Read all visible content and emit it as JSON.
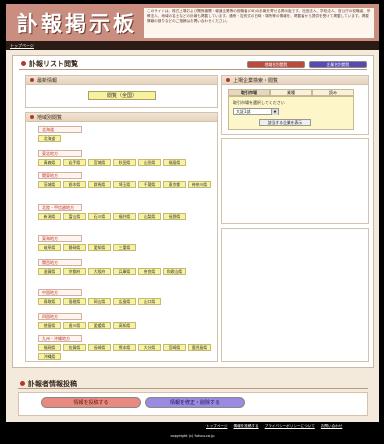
{
  "header": {
    "logo_text": "訃報掲示板",
    "description": "このサイトは、株式上場および関係機関・報道企業等の役職者(OB)の訃報を寄せる掲示板です。社団法人、学校法人、官公庁の役職者、宗教法人、地域の名士などの訃報も掲載しています。通夜・告別式の日時・場所等の情報を、掲載者から提供を受けて掲載しています。掲載情報の誤りなどのご指摘はお問い合わせください。"
  },
  "topbar": {
    "link": "トップページ"
  },
  "list_section": {
    "title": "訃報リスト閲覧",
    "tab1": "地域名別閲覧",
    "tab2": "企業名別閲覧"
  },
  "latest": {
    "heading": "最新情報",
    "button": "閲覧（全国）"
  },
  "regions": {
    "heading": "地域別閲覧",
    "list": [
      {
        "name": "北海道",
        "prefs": [
          "北海道"
        ]
      },
      {
        "name": "東北地方",
        "prefs": [
          "青森県",
          "岩手県",
          "宮城県",
          "秋田県",
          "山形県",
          "福島県"
        ]
      },
      {
        "name": "関東地方",
        "prefs": [
          "茨城県",
          "栃木県",
          "群馬県",
          "埼玉県",
          "千葉県",
          "東京都",
          "神奈川県"
        ]
      },
      {
        "name": "北陸・甲信越地方",
        "prefs": [
          "新潟県",
          "富山県",
          "石川県",
          "福井県",
          "山梨県",
          "長野県"
        ]
      },
      {
        "name": "東海地方",
        "prefs": [
          "岐阜県",
          "静岡県",
          "愛知県",
          "三重県"
        ]
      },
      {
        "name": "関西地方",
        "prefs": [
          "滋賀県",
          "京都府",
          "大阪府",
          "兵庫県",
          "奈良県",
          "和歌山県"
        ]
      },
      {
        "name": "中国地方",
        "prefs": [
          "鳥取県",
          "島根県",
          "岡山県",
          "広島県",
          "山口県"
        ]
      },
      {
        "name": "四国地方",
        "prefs": [
          "徳島県",
          "香川県",
          "愛媛県",
          "高知県"
        ]
      },
      {
        "name": "九州・沖縄地方",
        "prefs": [
          "福岡県",
          "佐賀県",
          "長崎県",
          "熊本県",
          "大分県",
          "宮崎県",
          "鹿児島県",
          "沖縄県"
        ]
      }
    ]
  },
  "search": {
    "heading": "上場企業検索・閲覧",
    "tabs": [
      "取引市場",
      "業種",
      "読み"
    ],
    "hint": "取引市場を選択してください",
    "select_value": "大証1部",
    "button": "該当する企業を表示"
  },
  "post_section": {
    "title": "訃報者情報投稿",
    "btn1": "情報を投稿する",
    "btn2": "情報を修正・削除する"
  },
  "footer": {
    "links": [
      "トップページ",
      "情報を投稿する",
      "プライバシーポリシーについて",
      "お問い合わせ"
    ],
    "copyright": "copyright (c) fuhou.co.jp"
  }
}
